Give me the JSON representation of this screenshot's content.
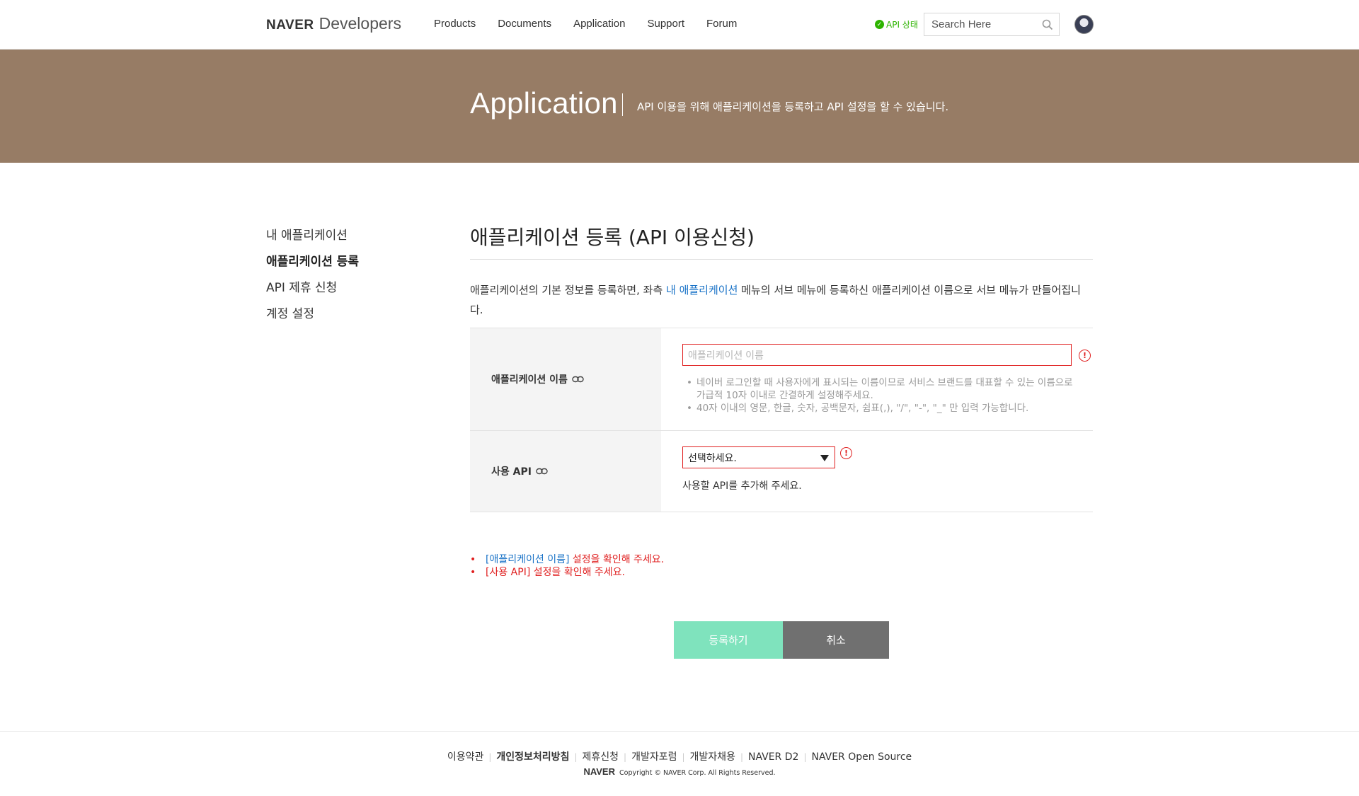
{
  "header": {
    "logo_naver": "NAVER",
    "logo_dev": "Developers",
    "nav": [
      "Products",
      "Documents",
      "Application",
      "Support",
      "Forum"
    ],
    "api_status": "API 상태",
    "search_placeholder": "Search Here"
  },
  "banner": {
    "title": "Application",
    "description": "API 이용을 위해 애플리케이션을 등록하고 API 설정을 할 수 있습니다."
  },
  "sidebar": {
    "items": [
      {
        "label": "내 애플리케이션",
        "active": false
      },
      {
        "label": "애플리케이션 등록",
        "active": true
      },
      {
        "label": "API 제휴 신청",
        "active": false
      },
      {
        "label": "계정 설정",
        "active": false
      }
    ]
  },
  "main": {
    "title": "애플리케이션 등록 (API 이용신청)",
    "intro_before": "애플리케이션의 기본 정보를 등록하면, 좌측 ",
    "intro_link": "내 애플리케이션",
    "intro_after": " 메뉴의 서브 메뉴에 등록하신 애플리케이션 이름으로 서브 메뉴가 만들어집니다."
  },
  "form": {
    "app_name_label": "애플리케이션 이름",
    "app_name_placeholder": "애플리케이션 이름",
    "app_name_value": "",
    "hints": [
      "네이버 로그인할 때 사용자에게 표시되는 이름이므로 서비스 브랜드를 대표할 수 있는 이름으로 가급적 10자 이내로 간결하게 설정해주세요.",
      "40자 이내의 영문, 한글, 숫자, 공백문자, 쉼표(,), \"/\", \"-\", \"_\" 만 입력 가능합니다."
    ],
    "api_label": "사용 API",
    "api_select_value": "선택하세요.",
    "api_help": "사용할 API를 추가해 주세요.",
    "warn_symbol": "!"
  },
  "errors": [
    {
      "link": "[애플리케이션 이름]",
      "text": " 설정을 확인해 주세요."
    },
    {
      "link": "",
      "text": "[사용 API] 설정을 확인해 주세요."
    }
  ],
  "buttons": {
    "register": "등록하기",
    "cancel": "취소"
  },
  "footer": {
    "links": [
      "이용약관",
      "개인정보처리방침",
      "제휴신청",
      "개발자포럼",
      "개발자채용",
      "NAVER D2",
      "NAVER Open Source"
    ],
    "naver_mark": "NAVER",
    "copyright": "Copyright © NAVER Corp. All Rights Reserved."
  },
  "colors": {
    "banner": "#977c65",
    "register_button": "#7fe3bd",
    "cancel_button": "#707070",
    "error": "#e02020",
    "link": "#1a73c7",
    "status_ok": "#2db400"
  },
  "icons": [
    "check-circle-icon",
    "search-icon",
    "link-icon",
    "warning-icon",
    "chevron-down-icon"
  ]
}
